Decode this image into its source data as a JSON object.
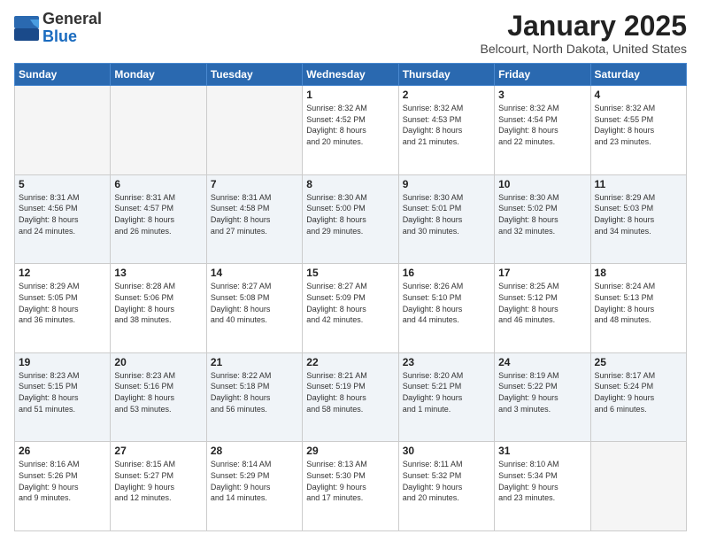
{
  "header": {
    "logo_general": "General",
    "logo_blue": "Blue",
    "title": "January 2025",
    "subtitle": "Belcourt, North Dakota, United States"
  },
  "weekdays": [
    "Sunday",
    "Monday",
    "Tuesday",
    "Wednesday",
    "Thursday",
    "Friday",
    "Saturday"
  ],
  "weeks": [
    [
      {
        "day": "",
        "info": ""
      },
      {
        "day": "",
        "info": ""
      },
      {
        "day": "",
        "info": ""
      },
      {
        "day": "1",
        "info": "Sunrise: 8:32 AM\nSunset: 4:52 PM\nDaylight: 8 hours\nand 20 minutes."
      },
      {
        "day": "2",
        "info": "Sunrise: 8:32 AM\nSunset: 4:53 PM\nDaylight: 8 hours\nand 21 minutes."
      },
      {
        "day": "3",
        "info": "Sunrise: 8:32 AM\nSunset: 4:54 PM\nDaylight: 8 hours\nand 22 minutes."
      },
      {
        "day": "4",
        "info": "Sunrise: 8:32 AM\nSunset: 4:55 PM\nDaylight: 8 hours\nand 23 minutes."
      }
    ],
    [
      {
        "day": "5",
        "info": "Sunrise: 8:31 AM\nSunset: 4:56 PM\nDaylight: 8 hours\nand 24 minutes."
      },
      {
        "day": "6",
        "info": "Sunrise: 8:31 AM\nSunset: 4:57 PM\nDaylight: 8 hours\nand 26 minutes."
      },
      {
        "day": "7",
        "info": "Sunrise: 8:31 AM\nSunset: 4:58 PM\nDaylight: 8 hours\nand 27 minutes."
      },
      {
        "day": "8",
        "info": "Sunrise: 8:30 AM\nSunset: 5:00 PM\nDaylight: 8 hours\nand 29 minutes."
      },
      {
        "day": "9",
        "info": "Sunrise: 8:30 AM\nSunset: 5:01 PM\nDaylight: 8 hours\nand 30 minutes."
      },
      {
        "day": "10",
        "info": "Sunrise: 8:30 AM\nSunset: 5:02 PM\nDaylight: 8 hours\nand 32 minutes."
      },
      {
        "day": "11",
        "info": "Sunrise: 8:29 AM\nSunset: 5:03 PM\nDaylight: 8 hours\nand 34 minutes."
      }
    ],
    [
      {
        "day": "12",
        "info": "Sunrise: 8:29 AM\nSunset: 5:05 PM\nDaylight: 8 hours\nand 36 minutes."
      },
      {
        "day": "13",
        "info": "Sunrise: 8:28 AM\nSunset: 5:06 PM\nDaylight: 8 hours\nand 38 minutes."
      },
      {
        "day": "14",
        "info": "Sunrise: 8:27 AM\nSunset: 5:08 PM\nDaylight: 8 hours\nand 40 minutes."
      },
      {
        "day": "15",
        "info": "Sunrise: 8:27 AM\nSunset: 5:09 PM\nDaylight: 8 hours\nand 42 minutes."
      },
      {
        "day": "16",
        "info": "Sunrise: 8:26 AM\nSunset: 5:10 PM\nDaylight: 8 hours\nand 44 minutes."
      },
      {
        "day": "17",
        "info": "Sunrise: 8:25 AM\nSunset: 5:12 PM\nDaylight: 8 hours\nand 46 minutes."
      },
      {
        "day": "18",
        "info": "Sunrise: 8:24 AM\nSunset: 5:13 PM\nDaylight: 8 hours\nand 48 minutes."
      }
    ],
    [
      {
        "day": "19",
        "info": "Sunrise: 8:23 AM\nSunset: 5:15 PM\nDaylight: 8 hours\nand 51 minutes."
      },
      {
        "day": "20",
        "info": "Sunrise: 8:23 AM\nSunset: 5:16 PM\nDaylight: 8 hours\nand 53 minutes."
      },
      {
        "day": "21",
        "info": "Sunrise: 8:22 AM\nSunset: 5:18 PM\nDaylight: 8 hours\nand 56 minutes."
      },
      {
        "day": "22",
        "info": "Sunrise: 8:21 AM\nSunset: 5:19 PM\nDaylight: 8 hours\nand 58 minutes."
      },
      {
        "day": "23",
        "info": "Sunrise: 8:20 AM\nSunset: 5:21 PM\nDaylight: 9 hours\nand 1 minute."
      },
      {
        "day": "24",
        "info": "Sunrise: 8:19 AM\nSunset: 5:22 PM\nDaylight: 9 hours\nand 3 minutes."
      },
      {
        "day": "25",
        "info": "Sunrise: 8:17 AM\nSunset: 5:24 PM\nDaylight: 9 hours\nand 6 minutes."
      }
    ],
    [
      {
        "day": "26",
        "info": "Sunrise: 8:16 AM\nSunset: 5:26 PM\nDaylight: 9 hours\nand 9 minutes."
      },
      {
        "day": "27",
        "info": "Sunrise: 8:15 AM\nSunset: 5:27 PM\nDaylight: 9 hours\nand 12 minutes."
      },
      {
        "day": "28",
        "info": "Sunrise: 8:14 AM\nSunset: 5:29 PM\nDaylight: 9 hours\nand 14 minutes."
      },
      {
        "day": "29",
        "info": "Sunrise: 8:13 AM\nSunset: 5:30 PM\nDaylight: 9 hours\nand 17 minutes."
      },
      {
        "day": "30",
        "info": "Sunrise: 8:11 AM\nSunset: 5:32 PM\nDaylight: 9 hours\nand 20 minutes."
      },
      {
        "day": "31",
        "info": "Sunrise: 8:10 AM\nSunset: 5:34 PM\nDaylight: 9 hours\nand 23 minutes."
      },
      {
        "day": "",
        "info": ""
      }
    ]
  ]
}
